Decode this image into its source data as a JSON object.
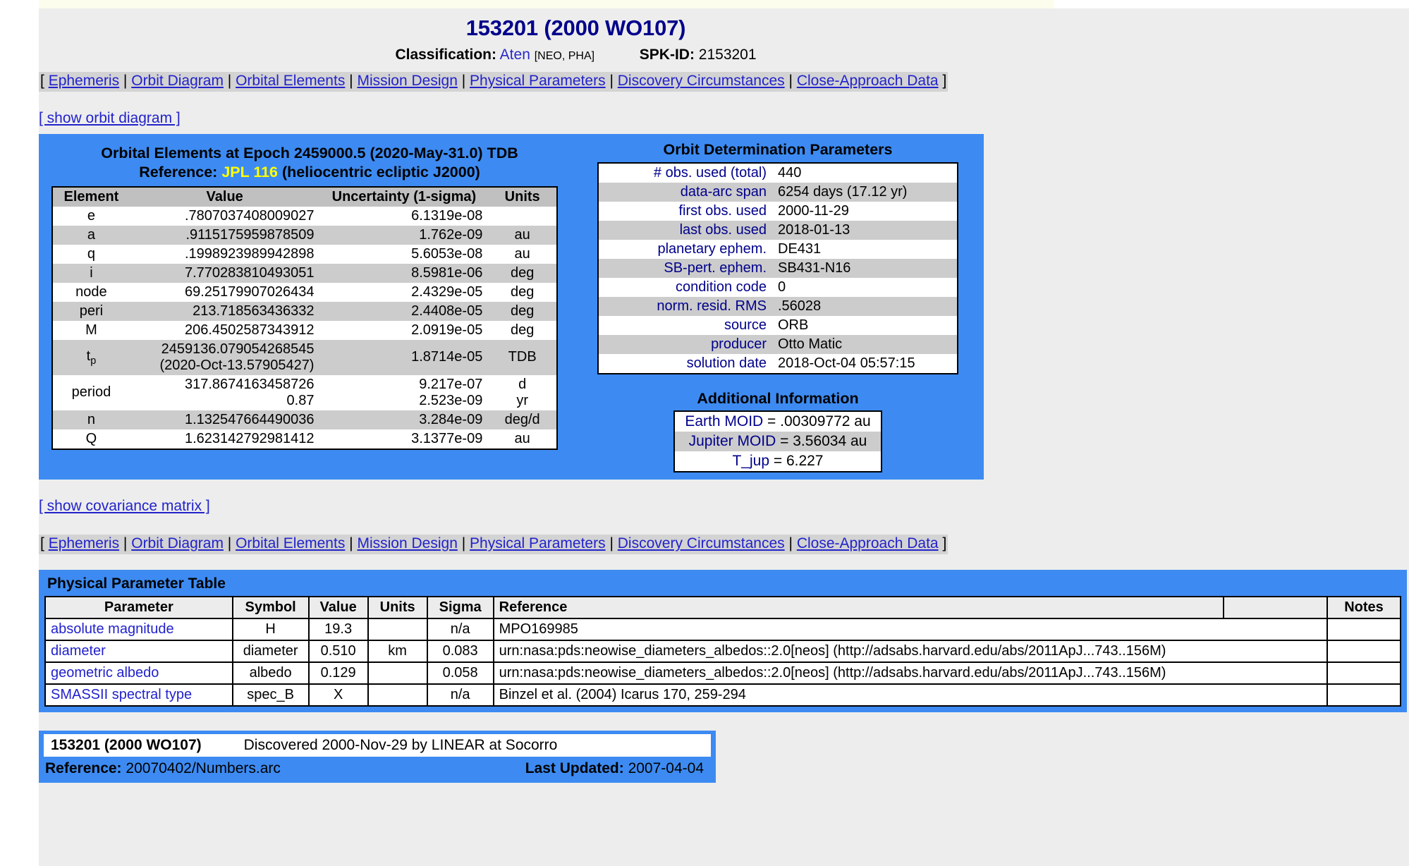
{
  "header": {
    "object_title": "153201 (2000 WO107)",
    "classification_label": "Classification:",
    "classification_value": "Aten",
    "classification_flags": "[NEO, PHA]",
    "spkid_label": "SPK-ID:",
    "spkid_value": "2153201"
  },
  "nav": {
    "open_bracket": "[",
    "close_bracket": "]",
    "separator": "|",
    "items": [
      "Ephemeris",
      "Orbit Diagram",
      "Orbital Elements",
      "Mission Design",
      "Physical Parameters",
      "Discovery Circumstances",
      "Close-Approach Data"
    ]
  },
  "links": {
    "show_orbit_diagram": "[ show orbit diagram ]",
    "show_covariance_matrix": "[ show covariance matrix ]"
  },
  "orbital_elements": {
    "heading_line1": "Orbital Elements at Epoch 2459000.5 (2020-May-31.0) TDB",
    "heading_reference_label": "Reference:",
    "heading_reference_value": "JPL 116",
    "heading_frame": "(heliocentric ecliptic J2000)",
    "columns": [
      "Element",
      "Value",
      "Uncertainty (1-sigma)",
      "Units"
    ],
    "rows": [
      {
        "element": "e",
        "value": ".7807037408009027",
        "uncertainty": "6.1319e-08",
        "units": ""
      },
      {
        "element": "a",
        "value": ".9115175959878509",
        "uncertainty": "1.762e-09",
        "units": "au"
      },
      {
        "element": "q",
        "value": ".1998923989942898",
        "uncertainty": "5.6053e-08",
        "units": "au"
      },
      {
        "element": "i",
        "value": "7.770283810493051",
        "uncertainty": "8.5981e-06",
        "units": "deg"
      },
      {
        "element": "node",
        "value": "69.25179907026434",
        "uncertainty": "2.4329e-05",
        "units": "deg"
      },
      {
        "element": "peri",
        "value": "213.718563436332",
        "uncertainty": "2.4408e-05",
        "units": "deg"
      },
      {
        "element": "M",
        "value": "206.4502587343912",
        "uncertainty": "2.0919e-05",
        "units": "deg"
      },
      {
        "element": "tp",
        "value": "2459136.079054268545",
        "value2": "(2020-Oct-13.57905427)",
        "uncertainty": "1.8714e-05",
        "units": "TDB"
      },
      {
        "element": "period",
        "value": "317.8674163458726",
        "uncertainty": "9.217e-07",
        "units": "d",
        "value2": "0.87",
        "uncertainty2": "2.523e-09",
        "units2": "yr"
      },
      {
        "element": "n",
        "value": "1.132547664490036",
        "uncertainty": "3.284e-09",
        "units": "deg/d"
      },
      {
        "element": "Q",
        "value": "1.623142792981412",
        "uncertainty": "3.1377e-09",
        "units": "au"
      }
    ]
  },
  "orbit_determination": {
    "heading": "Orbit Determination Parameters",
    "rows": [
      {
        "key": "# obs. used (total)",
        "value": "440"
      },
      {
        "key": "data-arc span",
        "value": "6254 days (17.12 yr)"
      },
      {
        "key": "first obs. used",
        "value": "2000-11-29"
      },
      {
        "key": "last obs. used",
        "value": "2018-01-13"
      },
      {
        "key": "planetary ephem.",
        "value": "DE431"
      },
      {
        "key": "SB-pert. ephem.",
        "value": "SB431-N16"
      },
      {
        "key": "condition code",
        "value": "0"
      },
      {
        "key": "norm. resid. RMS",
        "value": ".56028"
      },
      {
        "key": "source",
        "value": "ORB"
      },
      {
        "key": "producer",
        "value": "Otto Matic"
      },
      {
        "key": "solution date",
        "value": "2018-Oct-04 05:57:15"
      }
    ]
  },
  "additional_information": {
    "heading": "Additional Information",
    "rows": [
      {
        "key": "Earth MOID",
        "eq": " = ",
        "value": ".00309772 au"
      },
      {
        "key": "Jupiter MOID",
        "eq": " = ",
        "value": "3.56034 au"
      },
      {
        "key": "T_jup",
        "eq": " = ",
        "value": "6.227"
      }
    ]
  },
  "physical_parameters": {
    "title": "Physical Parameter Table",
    "columns": [
      "Parameter",
      "Symbol",
      "Value",
      "Units",
      "Sigma",
      "Reference",
      "",
      "Notes"
    ],
    "rows": [
      {
        "parameter": "absolute magnitude",
        "symbol": "H",
        "value": "19.3",
        "units": "",
        "sigma": "n/a",
        "reference": "MPO169985",
        "notes": ""
      },
      {
        "parameter": "diameter",
        "symbol": "diameter",
        "value": "0.510",
        "units": "km",
        "sigma": "0.083",
        "reference": "urn:nasa:pds:neowise_diameters_albedos::2.0[neos] (http://adsabs.harvard.edu/abs/2011ApJ...743..156M)",
        "notes": ""
      },
      {
        "parameter": "geometric albedo",
        "symbol": "albedo",
        "value": "0.129",
        "units": "",
        "sigma": "0.058",
        "reference": "urn:nasa:pds:neowise_diameters_albedos::2.0[neos] (http://adsabs.harvard.edu/abs/2011ApJ...743..156M)",
        "notes": ""
      },
      {
        "parameter": "SMASSII spectral type",
        "symbol": "spec_B",
        "value": "X",
        "units": "",
        "sigma": "n/a",
        "reference": "Binzel et al. (2004) Icarus 170, 259-294",
        "notes": ""
      }
    ]
  },
  "discovery": {
    "name": "153201 (2000 WO107)",
    "text": "Discovered 2000-Nov-29 by LINEAR at Socorro",
    "reference_label": "Reference:",
    "reference_value": "20070402/Numbers.arc",
    "updated_label": "Last Updated:",
    "updated_value": "2007-04-04"
  },
  "colors": {
    "panel_blue": "#3d8bf2",
    "page_bg": "#ededed",
    "link_blue": "#2222cc",
    "title_blue": "#00008b",
    "highlight_yellow": "#ffff00",
    "row_shade": "#cccccc",
    "nav_bg": "#d3d3d3"
  }
}
